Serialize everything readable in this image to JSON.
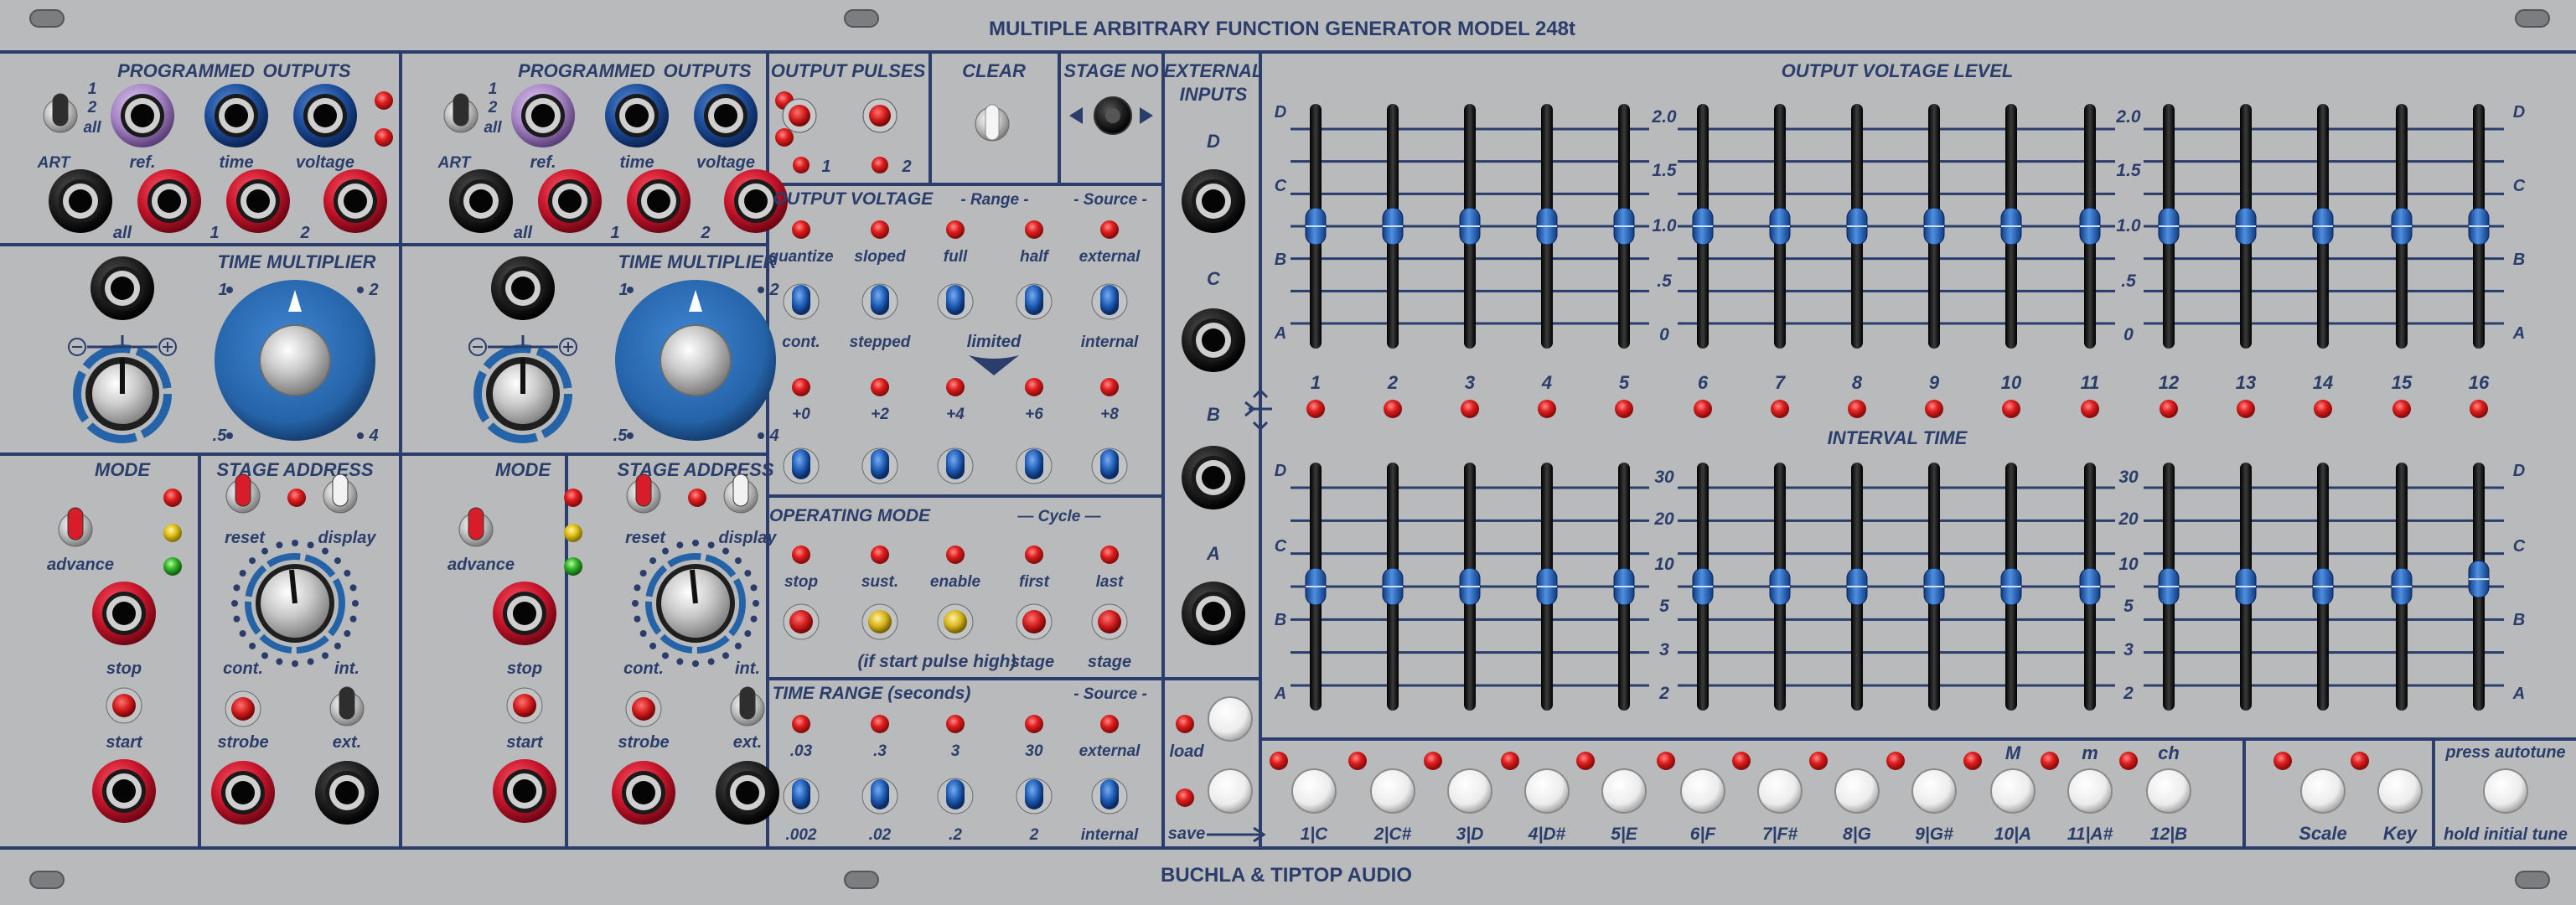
{
  "module": {
    "title": "MULTIPLE ARBITRARY FUNCTION GENERATOR MODEL 248t",
    "footer": "BUCHLA & TIPTOP AUDIO"
  },
  "colors": {
    "panel": "#b9babc",
    "ink": "#2b3d6b",
    "led_red": "#d11b1b",
    "led_yellow": "#e0c21a",
    "led_green": "#33b52b",
    "jack_red": "#c8142a",
    "jack_blue": "#1d4d9a",
    "jack_purple": "#a584c4",
    "knob_blue": "#2563a8"
  },
  "channel": {
    "programmed_outputs": "PROGRAMMED",
    "outputs": "OUTPUTS",
    "sw_1": "1",
    "sw_2": "2",
    "sw_all": "all",
    "art": "ART",
    "ref": "ref.",
    "time": "time",
    "voltage": "voltage",
    "out_all": "all",
    "out_1": "1",
    "out_2": "2",
    "time_multiplier": "TIME MULTIPLIER",
    "tm_1": "1",
    "tm_2": "2",
    "tm_5": ".5",
    "tm_4": "4",
    "mode": "MODE",
    "advance": "advance",
    "stop": "stop",
    "start": "start",
    "stage_address": "STAGE ADDRESS",
    "reset": "reset",
    "display": "display",
    "cont": "cont.",
    "int": "int.",
    "strobe": "strobe",
    "ext": "ext."
  },
  "output_pulses": {
    "title": "OUTPUT  PULSES",
    "p1": "1",
    "p2": "2"
  },
  "clear": {
    "title": "CLEAR"
  },
  "stage_no": {
    "title": "STAGE NO"
  },
  "external_inputs": {
    "title1": "EXTERNAL",
    "title2": "INPUTS",
    "d": "D",
    "c": "C",
    "b": "B",
    "a": "A"
  },
  "output_voltage": {
    "title": "OUTPUT VOLTAGE",
    "range": "- Range -",
    "source": "- Source -",
    "row1": [
      "quantize",
      "sloped",
      "full",
      "half",
      "external"
    ],
    "row2": [
      "cont.",
      "stepped",
      "",
      "",
      "internal"
    ],
    "limited": "limited",
    "row3": [
      "+0",
      "+2",
      "+4",
      "+6",
      "+8"
    ]
  },
  "operating_mode": {
    "title": "OPERATING MODE",
    "cycle": "— Cycle —",
    "row1": [
      "stop",
      "sust.",
      "enable",
      "first",
      "last"
    ],
    "note": "(if start pulse high)",
    "stage1": "stage",
    "stage2": "stage"
  },
  "time_range": {
    "title": "TIME RANGE (seconds)",
    "source": "- Source -",
    "row1": [
      ".03",
      ".3",
      "3",
      "30",
      "external"
    ],
    "row2": [
      ".002",
      ".02",
      ".2",
      "2",
      "internal"
    ]
  },
  "load": "load",
  "save": "save",
  "sliders": {
    "ovl_title": "OUTPUT VOLTAGE LEVEL",
    "it_title": "INTERVAL TIME",
    "abcd": [
      "D",
      "C",
      "B",
      "A"
    ],
    "ovl_scale": [
      "2.0",
      "1.5",
      "1.0",
      ".5",
      "0"
    ],
    "it_scale": [
      "30",
      "20",
      "10",
      "5",
      "3",
      "2"
    ],
    "stages": [
      "1",
      "2",
      "3",
      "4",
      "5",
      "6",
      "7",
      "8",
      "9",
      "10",
      "11",
      "12",
      "13",
      "14",
      "15",
      "16"
    ],
    "ovl_values": [
      0.5,
      0.5,
      0.5,
      0.5,
      0.5,
      0.5,
      0.5,
      0.5,
      0.5,
      0.5,
      0.5,
      0.5,
      0.5,
      0.5,
      0.5,
      0.5
    ],
    "it_values": [
      0.5,
      0.5,
      0.5,
      0.5,
      0.5,
      0.5,
      0.5,
      0.5,
      0.5,
      0.5,
      0.5,
      0.5,
      0.5,
      0.5,
      0.5,
      0.53
    ]
  },
  "keyboard": {
    "keys": [
      "1|C",
      "2|C#",
      "3|D",
      "4|D#",
      "5|E",
      "6|F",
      "7|F#",
      "8|G",
      "9|G#",
      "10|A",
      "11|A#",
      "12|B"
    ],
    "m_upper": "M",
    "m_lower": "m",
    "ch": "ch",
    "scale": "Scale",
    "key": "Key",
    "press_autotune": "press autotune",
    "hold_initial_tune": "hold initial tune"
  }
}
